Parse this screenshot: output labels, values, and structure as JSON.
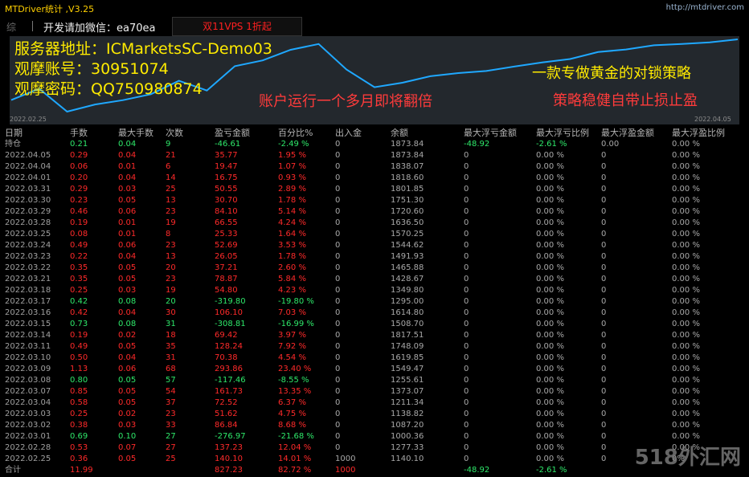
{
  "window": {
    "title": "MTDriver统计 ,V3.25",
    "url": "http://mtdriver.com"
  },
  "toolbar": {
    "summary_tab": "综",
    "contact": "开发请加微信：ea70ea",
    "promo": "双11VPS 1折起"
  },
  "chart": {
    "start_date": "2022.02.25",
    "end_date": "2022.04.05",
    "line_color": "#1fa8ff",
    "series": [
      1140.1,
      1277.33,
      1000.36,
      1087.2,
      1138.82,
      1211.34,
      1373.07,
      1255.61,
      1549.47,
      1619.85,
      1748.09,
      1817.51,
      1508.7,
      1295.0,
      1349.8,
      1428.67,
      1465.88,
      1491.93,
      1544.62,
      1594.61,
      1636.5,
      1720.6,
      1751.3,
      1801.85,
      1818.6,
      1838.07,
      1873.84
    ]
  },
  "overlay": {
    "server": "服务器地址：ICMarketsSC-Demo03",
    "account": "观摩账号：30951074",
    "password": "观摩密码：QQ750980874",
    "doubling": "账户运行一个多月即将翻倍",
    "strategy1": "一款专做黄金的对锁策略",
    "strategy2": "策略稳健自带止损止盈"
  },
  "columns": [
    "日期",
    "手数",
    "最大手数",
    "次数",
    "盈亏金额",
    "百分比%",
    "出入金",
    "余额",
    "最大浮亏金额",
    "最大浮亏比例",
    "最大浮盈金额",
    "最大浮盈比例"
  ],
  "rows": [
    [
      "持仓",
      "0.21",
      "0.04",
      "9",
      "-46.61",
      "-2.49 %",
      "0",
      "1873.84",
      "-48.92",
      "-2.61 %",
      "0.00",
      "0.00 %"
    ],
    [
      "2022.04.05",
      "0.29",
      "0.04",
      "21",
      "35.77",
      "1.95 %",
      "0",
      "1873.84",
      "0",
      "0.00 %",
      "0",
      "0.00 %"
    ],
    [
      "2022.04.04",
      "0.06",
      "0.01",
      "6",
      "19.47",
      "1.07 %",
      "0",
      "1838.07",
      "0",
      "0.00 %",
      "0",
      "0.00 %"
    ],
    [
      "2022.04.01",
      "0.20",
      "0.04",
      "14",
      "16.75",
      "0.93 %",
      "0",
      "1818.60",
      "0",
      "0.00 %",
      "0",
      "0.00 %"
    ],
    [
      "2022.03.31",
      "0.29",
      "0.03",
      "25",
      "50.55",
      "2.89 %",
      "0",
      "1801.85",
      "0",
      "0.00 %",
      "0",
      "0.00 %"
    ],
    [
      "2022.03.30",
      "0.23",
      "0.05",
      "13",
      "30.70",
      "1.78 %",
      "0",
      "1751.30",
      "0",
      "0.00 %",
      "0",
      "0.00 %"
    ],
    [
      "2022.03.29",
      "0.46",
      "0.06",
      "23",
      "84.10",
      "5.14 %",
      "0",
      "1720.60",
      "0",
      "0.00 %",
      "0",
      "0.00 %"
    ],
    [
      "2022.03.28",
      "0.19",
      "0.01",
      "19",
      "66.55",
      "4.24 %",
      "0",
      "1636.50",
      "0",
      "0.00 %",
      "0",
      "0.00 %"
    ],
    [
      "2022.03.25",
      "0.08",
      "0.01",
      "8",
      "25.33",
      "1.64 %",
      "0",
      "1570.25",
      "0",
      "0.00 %",
      "0",
      "0.00 %"
    ],
    [
      "2022.03.24",
      "0.49",
      "0.06",
      "23",
      "52.69",
      "3.53 %",
      "0",
      "1544.62",
      "0",
      "0.00 %",
      "0",
      "0.00 %"
    ],
    [
      "2022.03.23",
      "0.22",
      "0.04",
      "13",
      "26.05",
      "1.78 %",
      "0",
      "1491.93",
      "0",
      "0.00 %",
      "0",
      "0.00 %"
    ],
    [
      "2022.03.22",
      "0.35",
      "0.05",
      "20",
      "37.21",
      "2.60 %",
      "0",
      "1465.88",
      "0",
      "0.00 %",
      "0",
      "0.00 %"
    ],
    [
      "2022.03.21",
      "0.35",
      "0.05",
      "23",
      "78.87",
      "5.84 %",
      "0",
      "1428.67",
      "0",
      "0.00 %",
      "0",
      "0.00 %"
    ],
    [
      "2022.03.18",
      "0.25",
      "0.03",
      "19",
      "54.80",
      "4.23 %",
      "0",
      "1349.80",
      "0",
      "0.00 %",
      "0",
      "0.00 %"
    ],
    [
      "2022.03.17",
      "0.42",
      "0.08",
      "20",
      "-319.80",
      "-19.80 %",
      "0",
      "1295.00",
      "0",
      "0.00 %",
      "0",
      "0.00 %"
    ],
    [
      "2022.03.16",
      "0.42",
      "0.04",
      "30",
      "106.10",
      "7.03 %",
      "0",
      "1614.80",
      "0",
      "0.00 %",
      "0",
      "0.00 %"
    ],
    [
      "2022.03.15",
      "0.73",
      "0.08",
      "31",
      "-308.81",
      "-16.99 %",
      "0",
      "1508.70",
      "0",
      "0.00 %",
      "0",
      "0.00 %"
    ],
    [
      "2022.03.14",
      "0.19",
      "0.02",
      "18",
      "69.42",
      "3.97 %",
      "0",
      "1817.51",
      "0",
      "0.00 %",
      "0",
      "0.00 %"
    ],
    [
      "2022.03.11",
      "0.49",
      "0.05",
      "35",
      "128.24",
      "7.92 %",
      "0",
      "1748.09",
      "0",
      "0.00 %",
      "0",
      "0.00 %"
    ],
    [
      "2022.03.10",
      "0.50",
      "0.04",
      "31",
      "70.38",
      "4.54 %",
      "0",
      "1619.85",
      "0",
      "0.00 %",
      "0",
      "0.00 %"
    ],
    [
      "2022.03.09",
      "1.13",
      "0.06",
      "68",
      "293.86",
      "23.40 %",
      "0",
      "1549.47",
      "0",
      "0.00 %",
      "0",
      "0.00 %"
    ],
    [
      "2022.03.08",
      "0.80",
      "0.05",
      "57",
      "-117.46",
      "-8.55 %",
      "0",
      "1255.61",
      "0",
      "0.00 %",
      "0",
      "0.00 %"
    ],
    [
      "2022.03.07",
      "0.85",
      "0.05",
      "54",
      "161.73",
      "13.35 %",
      "0",
      "1373.07",
      "0",
      "0.00 %",
      "0",
      "0.00 %"
    ],
    [
      "2022.03.04",
      "0.58",
      "0.05",
      "37",
      "72.52",
      "6.37 %",
      "0",
      "1211.34",
      "0",
      "0.00 %",
      "0",
      "0.00 %"
    ],
    [
      "2022.03.03",
      "0.25",
      "0.02",
      "23",
      "51.62",
      "4.75 %",
      "0",
      "1138.82",
      "0",
      "0.00 %",
      "0",
      "0.00 %"
    ],
    [
      "2022.03.02",
      "0.38",
      "0.03",
      "33",
      "86.84",
      "8.68 %",
      "0",
      "1087.20",
      "0",
      "0.00 %",
      "0",
      "0.00 %"
    ],
    [
      "2022.03.01",
      "0.69",
      "0.10",
      "27",
      "-276.97",
      "-21.68 %",
      "0",
      "1000.36",
      "0",
      "0.00 %",
      "0",
      "0.00 %"
    ],
    [
      "2022.02.28",
      "0.53",
      "0.07",
      "27",
      "137.23",
      "12.04 %",
      "0",
      "1277.33",
      "0",
      "0.00 %",
      "0",
      "0.00 %"
    ],
    [
      "2022.02.25",
      "0.36",
      "0.05",
      "25",
      "140.10",
      "14.01 %",
      "1000",
      "1140.10",
      "0",
      "0.00 %",
      "0",
      "0%"
    ]
  ],
  "totals": [
    "合计",
    "11.99",
    "",
    "",
    "827.23",
    "82.72 %",
    "1000",
    "",
    "-48.92",
    "-2.61 %",
    "",
    ""
  ],
  "watermark": "518外汇网"
}
